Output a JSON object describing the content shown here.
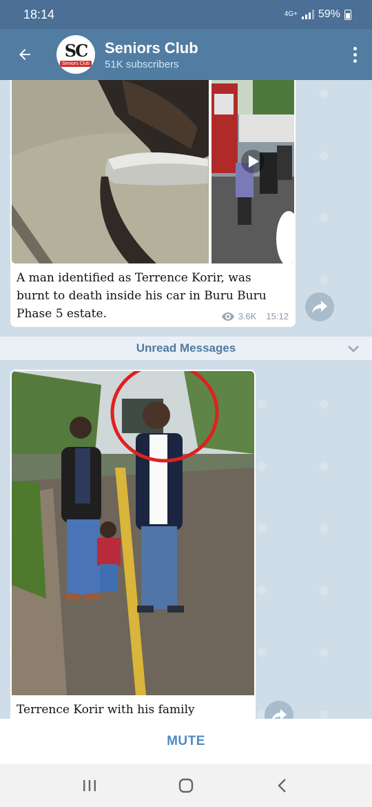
{
  "status_bar": {
    "time": "18:14",
    "network": "4G+",
    "battery": "59%"
  },
  "header": {
    "title": "Seniors Club",
    "subtitle": "51K subscribers",
    "avatar_letters": "SC",
    "avatar_tag": "Seniors Club"
  },
  "messages": [
    {
      "text": "A man identified as Terrence Korir, was burnt to death inside his car in Buru Buru Phase 5 estate.",
      "views": "3.6K",
      "time": "15:12"
    },
    {
      "text": "Terrence Korir with his family"
    }
  ],
  "divider": {
    "label": "Unread Messages"
  },
  "footer": {
    "mute_label": "MUTE"
  },
  "icons": {
    "back": "arrow-back-icon",
    "menu": "more-vert-icon",
    "play": "play-icon",
    "views": "eye-icon",
    "share": "share-icon",
    "nav_recent": "recent-apps-icon",
    "nav_home": "home-icon",
    "nav_back": "nav-back-icon"
  }
}
